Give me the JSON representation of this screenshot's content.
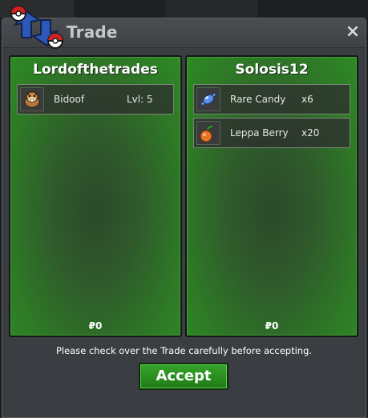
{
  "window": {
    "title": "Trade",
    "close_glyph": "×"
  },
  "trade": {
    "left": {
      "player": "Lordofthetrades",
      "items": [
        {
          "name": "Bidoof",
          "extra": "Lvl: 5",
          "icon": "bidoof-icon"
        }
      ],
      "money": "₽0"
    },
    "right": {
      "player": "Solosis12",
      "items": [
        {
          "name": "Rare Candy",
          "extra": "x6",
          "icon": "rare-candy-icon"
        },
        {
          "name": "Leppa Berry",
          "extra": "x20",
          "icon": "leppa-berry-icon"
        }
      ],
      "money": "₽0"
    }
  },
  "footer": {
    "notice": "Please check over the Trade carefully before accepting.",
    "accept_label": "Accept"
  },
  "colors": {
    "panel_green": "#2e7a26",
    "button_green": "#35a52a",
    "window_bg": "#3a3d41"
  }
}
